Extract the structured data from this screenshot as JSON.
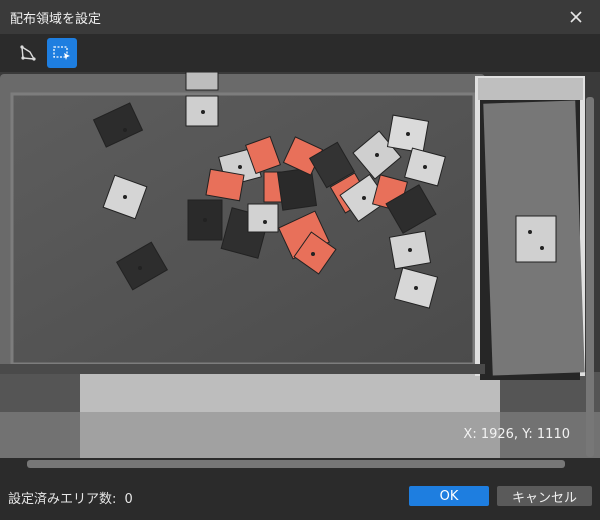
{
  "dialog": {
    "title": "配布領域を設定",
    "close_icon": "close-icon"
  },
  "toolbar": {
    "tools": [
      {
        "name": "polygon-tool",
        "icon": "polygon-icon",
        "active": false
      },
      {
        "name": "rectangle-tool",
        "icon": "rectangle-select-icon",
        "active": true
      }
    ]
  },
  "viewport": {
    "coordinate_readout": "X: 1926, Y: 1110",
    "highlight_color": "#e8705a"
  },
  "footer": {
    "status_label": "設定済みエリア数:",
    "status_count": "0",
    "ok_label": "OK",
    "cancel_label": "キャンセル"
  },
  "colors": {
    "accent": "#1e7ee0",
    "titlebar": "#3a3a3a",
    "background": "#2b2b2b"
  }
}
